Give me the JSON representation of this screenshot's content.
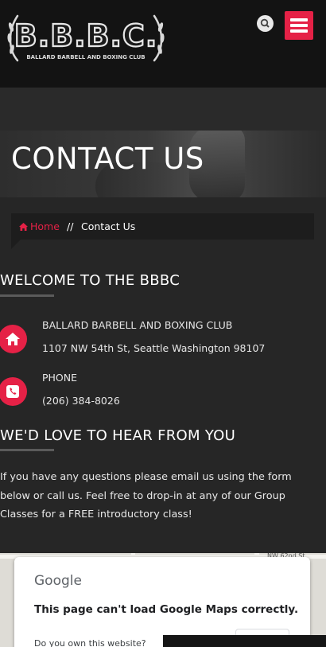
{
  "header": {
    "logo_text": "B.B.B.C.",
    "logo_subtext": "BALLARD BARBELL AND BOXING CLUB"
  },
  "banner": {
    "title": "CONTACT US"
  },
  "breadcrumb": {
    "home": "Home",
    "separator": "//",
    "current": "Contact Us"
  },
  "welcome": {
    "heading": "WELCOME TO THE BBBC",
    "club_name": "BALLARD BARBELL AND BOXING CLUB",
    "address": "1107 NW 54th St, Seattle Washington 98107",
    "phone_label": "PHONE",
    "phone": "(206) 384-8026"
  },
  "hear": {
    "heading": "WE'D LOVE TO HEAR FROM YOU",
    "text": "If you have any questions please email us using the form below or call us. Feel free to drop-in at any of our Group Classes for a FREE introductory class!"
  },
  "map": {
    "google": "Google",
    "error": "This page can't load Google Maps correctly.",
    "own_site": "Do you own this website?",
    "street_label": "NW 62nd St"
  },
  "icons": {
    "search": "search-icon",
    "menu": "hamburger-menu-icon",
    "home": "home-icon",
    "phone": "phone-icon"
  },
  "colors": {
    "accent": "#e52146",
    "background": "#262626",
    "header": "#131313"
  }
}
